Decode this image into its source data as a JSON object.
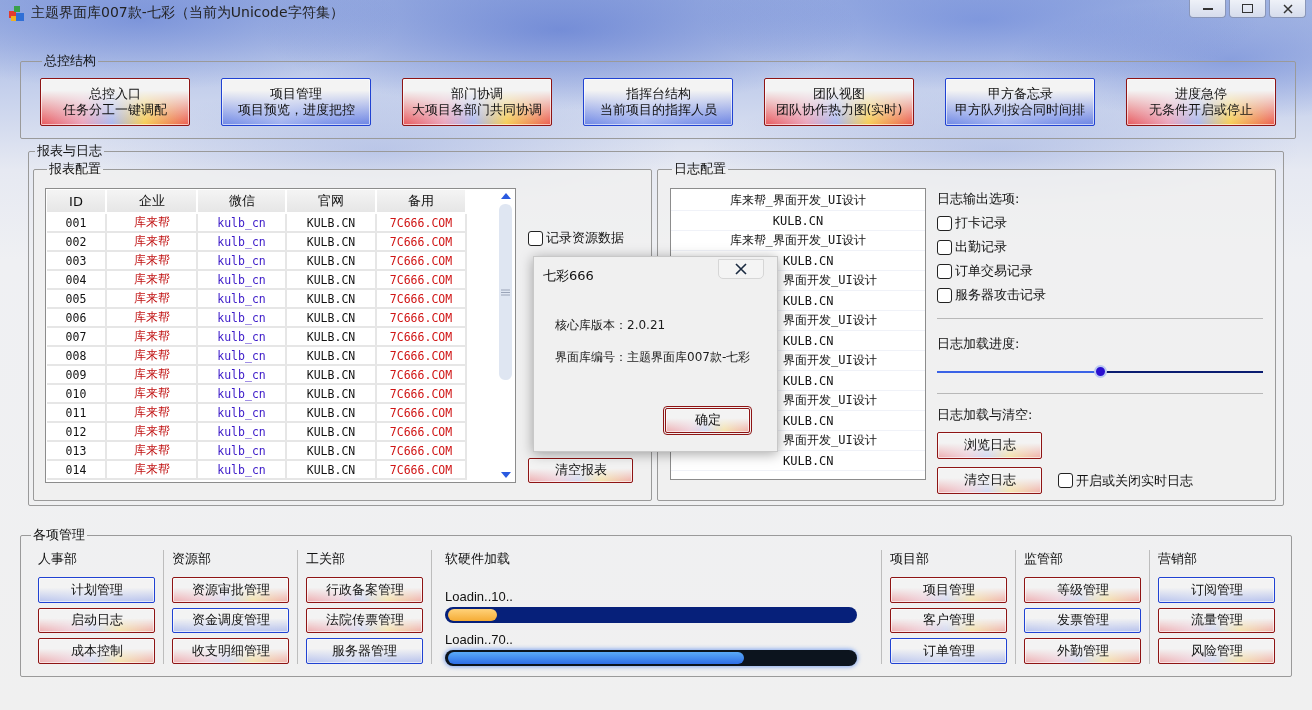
{
  "window": {
    "title": "主题界面库007款-七彩（当前为Unicode字符集）"
  },
  "control_group": {
    "title": "总控结构",
    "buttons": [
      {
        "lines": [
          "总控入口",
          "任务分工一键调配"
        ],
        "kind": "warm"
      },
      {
        "lines": [
          "项目管理",
          "项目预览，进度把控"
        ],
        "kind": "cool"
      },
      {
        "lines": [
          "部门协调",
          "大项目各部门共同协调"
        ],
        "kind": "warm"
      },
      {
        "lines": [
          "指挥台结构",
          "当前项目的指挥人员"
        ],
        "kind": "cool"
      },
      {
        "lines": [
          "团队视图",
          "团队协作热力图(实时)"
        ],
        "kind": "warm"
      },
      {
        "lines": [
          "甲方备忘录",
          "甲方队列按合同时间排"
        ],
        "kind": "cool"
      },
      {
        "lines": [
          "进度急停",
          "无条件开启或停止"
        ],
        "kind": "warm"
      }
    ]
  },
  "report_log": {
    "title": "报表与日志",
    "report": {
      "title": "报表配置",
      "table": {
        "columns": [
          "ID",
          "企业",
          "微信",
          "官网",
          "备用"
        ],
        "rows": [
          [
            "001",
            "库来帮",
            "kulb_cn",
            "KULB.CN",
            "7C666.COM"
          ],
          [
            "002",
            "库来帮",
            "kulb_cn",
            "KULB.CN",
            "7C666.COM"
          ],
          [
            "003",
            "库来帮",
            "kulb_cn",
            "KULB.CN",
            "7C666.COM"
          ],
          [
            "004",
            "库来帮",
            "kulb_cn",
            "KULB.CN",
            "7C666.COM"
          ],
          [
            "005",
            "库来帮",
            "kulb_cn",
            "KULB.CN",
            "7C666.COM"
          ],
          [
            "006",
            "库来帮",
            "kulb_cn",
            "KULB.CN",
            "7C666.COM"
          ],
          [
            "007",
            "库来帮",
            "kulb_cn",
            "KULB.CN",
            "7C666.COM"
          ],
          [
            "008",
            "库来帮",
            "kulb_cn",
            "KULB.CN",
            "7C666.COM"
          ],
          [
            "009",
            "库来帮",
            "kulb_cn",
            "KULB.CN",
            "7C666.COM"
          ],
          [
            "010",
            "库来帮",
            "kulb_cn",
            "KULB.CN",
            "7C666.COM"
          ],
          [
            "011",
            "库来帮",
            "kulb_cn",
            "KULB.CN",
            "7C666.COM"
          ],
          [
            "012",
            "库来帮",
            "kulb_cn",
            "KULB.CN",
            "7C666.COM"
          ],
          [
            "013",
            "库来帮",
            "kulb_cn",
            "KULB.CN",
            "7C666.COM"
          ],
          [
            "014",
            "库来帮",
            "kulb_cn",
            "KULB.CN",
            "7C666.COM"
          ]
        ]
      },
      "checkboxes": [
        {
          "label": "记录资源数据",
          "checked": false
        }
      ],
      "buttons": [
        {
          "label": "清空报表",
          "kind": "warm"
        }
      ]
    },
    "log": {
      "title": "日志配置",
      "entries": [
        "库来帮_界面开发_UI设计",
        "KULB.CN",
        "库来帮_界面开发_UI设计",
        "KULB.CN",
        "界面开发_UI设计",
        "KULB.CN",
        "界面开发_UI设计",
        "KULB.CN",
        "界面开发_UI设计",
        "KULB.CN",
        "界面开发_UI设计",
        "KULB.CN",
        "界面开发_UI设计",
        "KULB.CN"
      ],
      "output_title": "日志输出选项:",
      "options": [
        {
          "label": "打卡记录",
          "checked": false
        },
        {
          "label": "出勤记录",
          "checked": false
        },
        {
          "label": "订单交易记录",
          "checked": false
        },
        {
          "label": "服务器攻击记录",
          "checked": false
        }
      ],
      "progress_title": "日志加载进度:",
      "slider": {
        "level": 0.5
      },
      "actions_title": "日志加载与清空:",
      "buttons": [
        {
          "label": "浏览日志",
          "kind": "warm"
        },
        {
          "label": "清空日志",
          "kind": "warm"
        }
      ],
      "realtime": {
        "label": "开启或关闭实时日志",
        "checked": false
      }
    }
  },
  "management": {
    "title": "各项管理",
    "sections": [
      {
        "kind": "buttons",
        "title": "人事部",
        "buttons": [
          {
            "label": "计划管理",
            "kind": "cool"
          },
          {
            "label": "启动日志",
            "kind": "warm"
          },
          {
            "label": "成本控制",
            "kind": "warm"
          }
        ]
      },
      {
        "kind": "buttons",
        "title": "资源部",
        "buttons": [
          {
            "label": "资源审批管理",
            "kind": "warm"
          },
          {
            "label": "资金调度管理",
            "kind": "cool"
          },
          {
            "label": "收支明细管理",
            "kind": "warm"
          }
        ]
      },
      {
        "kind": "buttons",
        "title": "工关部",
        "buttons": [
          {
            "label": "行政备案管理",
            "kind": "warm"
          },
          {
            "label": "法院传票管理",
            "kind": "warm"
          },
          {
            "label": "服务器管理",
            "kind": "cool"
          }
        ]
      },
      {
        "kind": "loading",
        "title": "软硬件加载",
        "bars": [
          {
            "label": "Loadin..10..",
            "level": 0.12,
            "kind": "amber"
          },
          {
            "label": "Loadin..70..",
            "level": 0.73,
            "kind": "blue"
          }
        ]
      },
      {
        "kind": "buttons",
        "title": "项目部",
        "buttons": [
          {
            "label": "项目管理",
            "kind": "warm"
          },
          {
            "label": "客户管理",
            "kind": "warm"
          },
          {
            "label": "订单管理",
            "kind": "cool"
          }
        ]
      },
      {
        "kind": "buttons",
        "title": "监管部",
        "buttons": [
          {
            "label": "等级管理",
            "kind": "warm"
          },
          {
            "label": "发票管理",
            "kind": "cool"
          },
          {
            "label": "外勤管理",
            "kind": "warm"
          }
        ]
      },
      {
        "kind": "buttons",
        "title": "营销部",
        "buttons": [
          {
            "label": "订阅管理",
            "kind": "cool"
          },
          {
            "label": "流量管理",
            "kind": "warm"
          },
          {
            "label": "风险管理",
            "kind": "warm"
          }
        ]
      }
    ]
  },
  "dialog": {
    "title": "七彩666",
    "lines": [
      "核心库版本：2.0.21",
      "界面库编号：主题界面库007款-七彩"
    ],
    "button": "确定"
  }
}
